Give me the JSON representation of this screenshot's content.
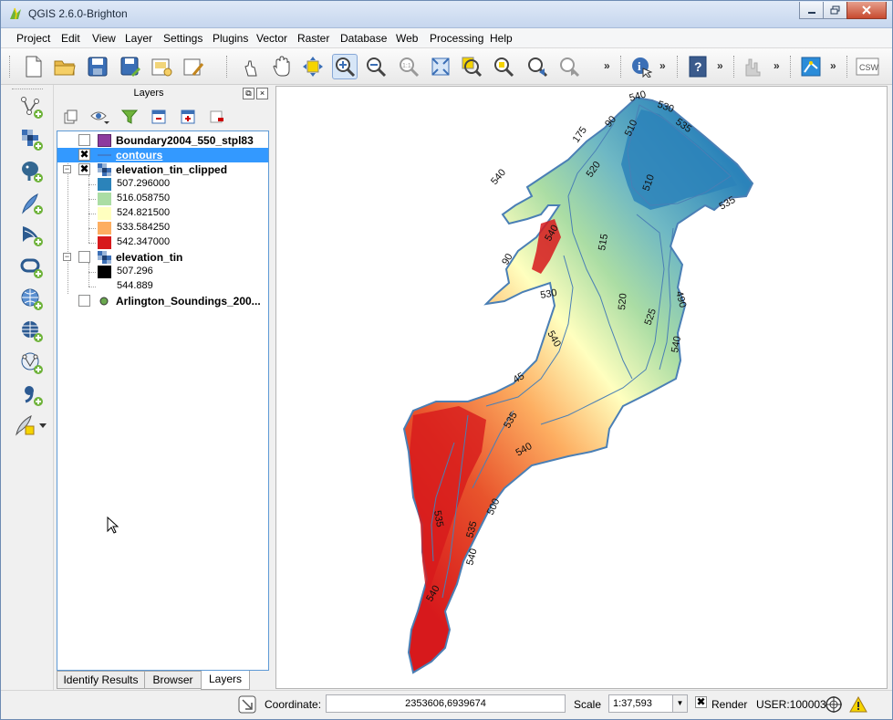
{
  "window": {
    "title": "QGIS 2.6.0-Brighton"
  },
  "menu": {
    "items": [
      {
        "label": "Project",
        "key": "P"
      },
      {
        "label": "Edit",
        "key": "E"
      },
      {
        "label": "View",
        "key": "V"
      },
      {
        "label": "Layer",
        "key": "L"
      },
      {
        "label": "Settings",
        "key": "S"
      },
      {
        "label": "Plugins",
        "key": "P"
      },
      {
        "label": "Vector",
        "key": "o"
      },
      {
        "label": "Raster",
        "key": "R"
      },
      {
        "label": "Database",
        "key": "D"
      },
      {
        "label": "Web",
        "key": "W"
      },
      {
        "label": "Processing",
        "key": "P"
      },
      {
        "label": "Help",
        "key": "H"
      }
    ]
  },
  "toolbar": {
    "overflow_glyph": "»",
    "csw_label": "CSW",
    "zoom_actual_label": "1:1"
  },
  "layers_panel": {
    "title": "Layers",
    "float_glyph": "⧉",
    "close_glyph": "×",
    "layers": [
      {
        "name": "Boundary2004_550_stpl83",
        "checked": false,
        "color": "#8e3a9e"
      },
      {
        "name": "contours",
        "checked": true,
        "color": "#3d7fd1",
        "selected": true
      },
      {
        "name": "elevation_tin_clipped",
        "checked": true,
        "legend": [
          {
            "value": "507.296000",
            "color": "#2b83ba"
          },
          {
            "value": "516.058750",
            "color": "#abdda4"
          },
          {
            "value": "524.821500",
            "color": "#ffffbf"
          },
          {
            "value": "533.584250",
            "color": "#fdae61"
          },
          {
            "value": "542.347000",
            "color": "#d7191c"
          }
        ]
      },
      {
        "name": "elevation_tin",
        "checked": false,
        "legend": [
          {
            "value": "507.296",
            "color": "#000000"
          },
          {
            "value": "544.889",
            "color": "#ffffff"
          }
        ]
      },
      {
        "name": "Arlington_Soundings_200...",
        "checked": false,
        "color": "#6aa84f"
      }
    ],
    "tabs": [
      {
        "label": "Identify Results",
        "active": false
      },
      {
        "label": "Browser",
        "active": false
      },
      {
        "label": "Layers",
        "active": true
      }
    ]
  },
  "map": {
    "contour_labels": [
      "540",
      "530",
      "535",
      "90",
      "175",
      "510",
      "520",
      "540",
      "510",
      "535",
      "540",
      "515",
      "90",
      "530",
      "520",
      "490",
      "525",
      "540",
      "540",
      "45",
      "535",
      "540",
      "535",
      "500",
      "535",
      "540",
      "540"
    ],
    "colors": {
      "low": "#2b83ba",
      "mid_low": "#abdda4",
      "mid": "#ffffbf",
      "mid_high": "#fdae61",
      "high": "#d7191c",
      "contour": "#4a7fb5"
    }
  },
  "statusbar": {
    "coordinate_label": "Coordinate:",
    "coordinate_value": "2353606,6939674",
    "scale_label": "Scale",
    "scale_value": "1:37,593",
    "render_label": "Render",
    "render_checked": true,
    "crs_label": "USER:100003"
  }
}
